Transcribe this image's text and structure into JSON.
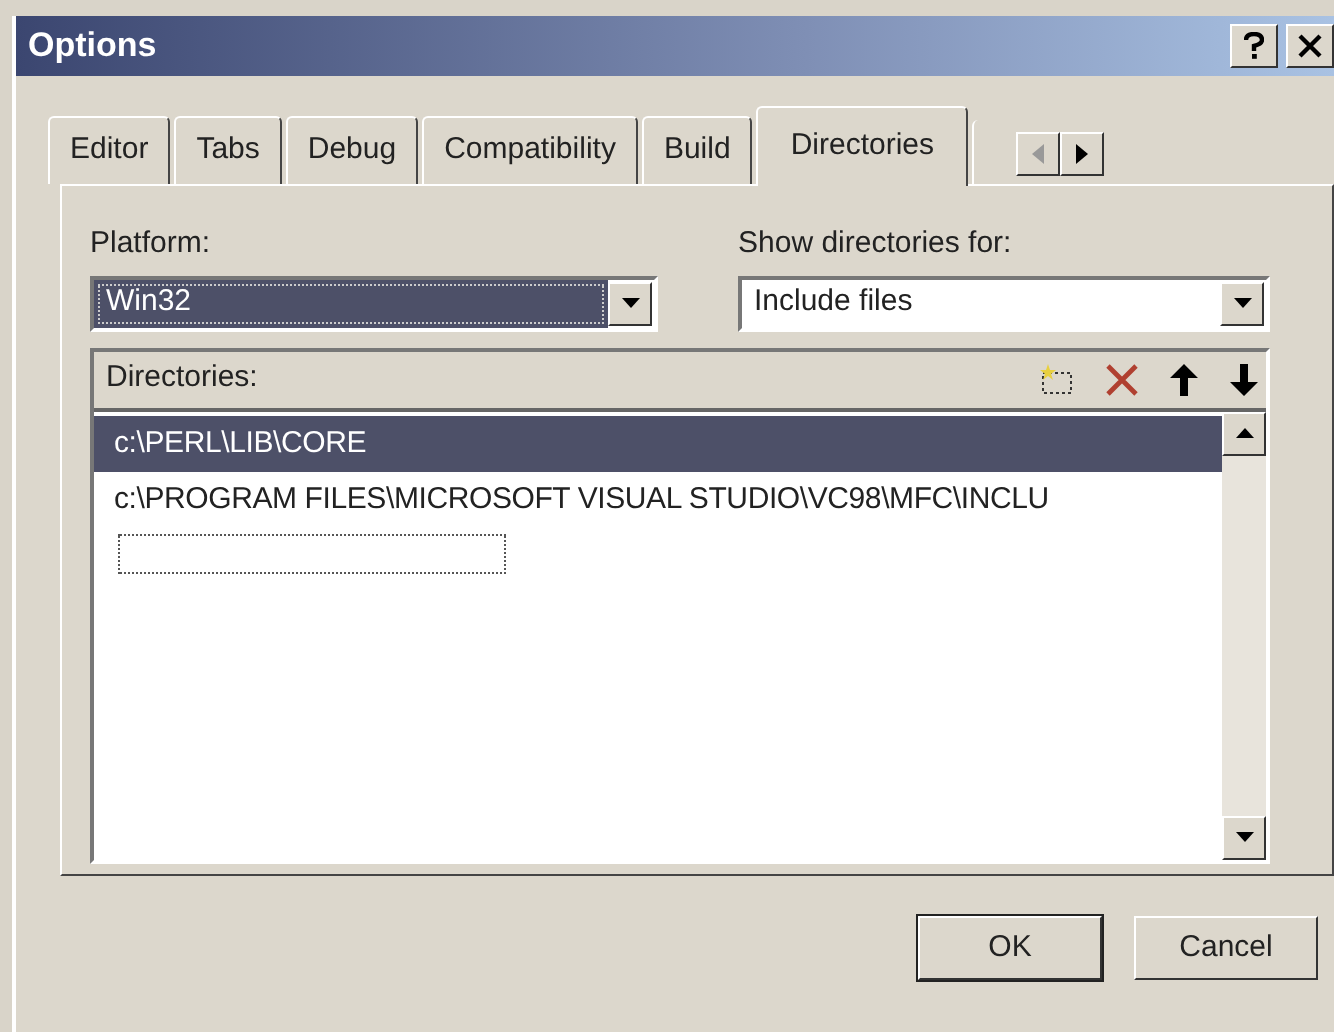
{
  "window": {
    "title": "Options"
  },
  "tabs": [
    {
      "label": "Editor",
      "selected": false
    },
    {
      "label": "Tabs",
      "selected": false
    },
    {
      "label": "Debug",
      "selected": false
    },
    {
      "label": "Compatibility",
      "selected": false
    },
    {
      "label": "Build",
      "selected": false
    },
    {
      "label": "Directories",
      "selected": true
    }
  ],
  "platform": {
    "label": "Platform:",
    "value": "Win32",
    "focused": true
  },
  "show_for": {
    "label": "Show directories for:",
    "value": "Include files",
    "focused": false
  },
  "directories": {
    "label": "Directories:",
    "items": [
      {
        "text": "c:\\PERL\\LIB\\CORE",
        "selected": true
      },
      {
        "text": "c:\\PROGRAM FILES\\MICROSOFT VISUAL STUDIO\\VC98\\MFC\\INCLU",
        "selected": false
      }
    ]
  },
  "buttons": [
    {
      "label": "OK",
      "default": true
    },
    {
      "label": "Cancel",
      "default": false
    }
  ]
}
